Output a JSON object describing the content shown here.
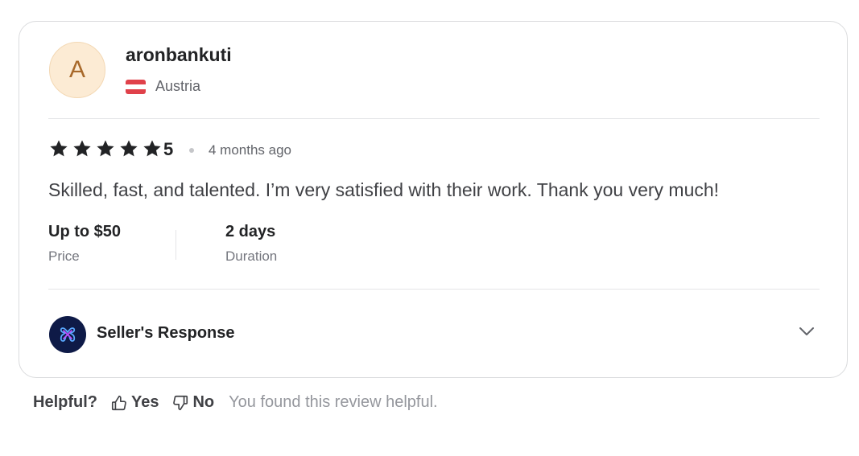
{
  "reviewer": {
    "avatar_letter": "A",
    "username": "aronbankuti",
    "country": "Austria",
    "flag_colors": [
      "#e0414a",
      "#ffffff",
      "#e0414a"
    ]
  },
  "review": {
    "rating": 5,
    "rating_label": "5",
    "time_ago": "4 months ago",
    "text": "Skilled, fast, and talented. I’m very satisfied with their work. Thank you very much!"
  },
  "details": {
    "price_value": "Up to $50",
    "price_label": "Price",
    "duration_value": "2 days",
    "duration_label": "Duration"
  },
  "seller_response": {
    "title": "Seller's Response",
    "logo_icon": "seller-logo-icon"
  },
  "helpful": {
    "label": "Helpful?",
    "yes_label": "Yes",
    "no_label": "No",
    "status_text": "You found this review helpful."
  },
  "colors": {
    "star": "#222325",
    "avatar_bg": "#fcebd4",
    "avatar_text": "#a8692a",
    "seller_logo_bg": "#0e1a47"
  }
}
